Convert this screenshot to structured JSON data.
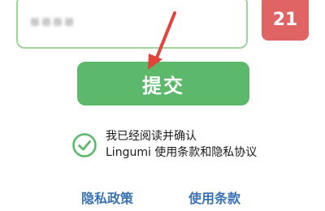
{
  "verification": {
    "countdown": "21"
  },
  "submit": {
    "label": "提交"
  },
  "agreement": {
    "checked": true,
    "line1": "我已经阅读并确认",
    "line2": "Lingumi 使用条款和隐私协议"
  },
  "links": {
    "privacy": "隐私政策",
    "terms": "使用条款"
  },
  "icons": {
    "check": "check-circle-icon",
    "annotation": "red-arrow"
  },
  "colors": {
    "accent_green": "#5cb86a",
    "input_border": "#9fd49a",
    "countdown_red": "#e06464",
    "link_blue": "#3a73b5",
    "arrow_red": "#e0443a"
  }
}
